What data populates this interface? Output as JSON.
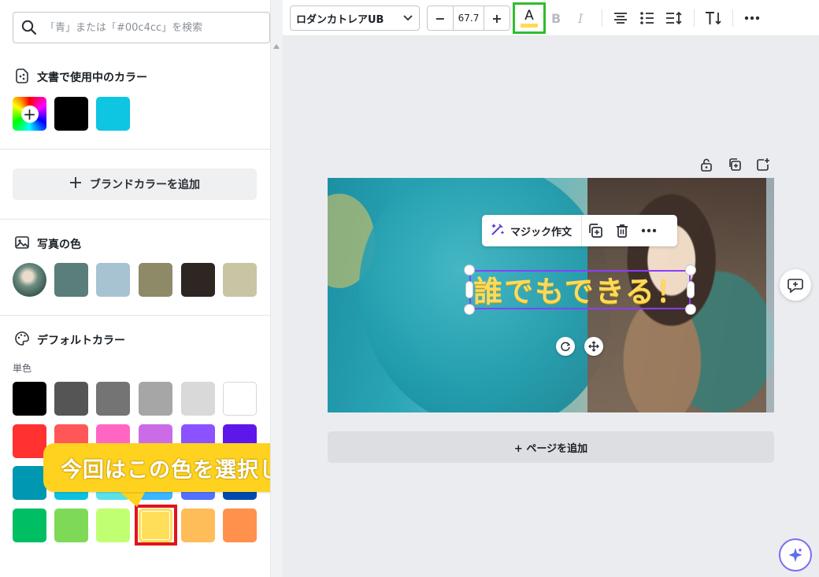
{
  "search": {
    "placeholder": "「青」または「#00c4cc」を検索"
  },
  "sections": {
    "document_colors": "文書で使用中のカラー",
    "brand_button": "ブランドカラーを追加",
    "photo_colors": "写真の色",
    "default_colors": "デフォルトカラー",
    "solid_label": "単色"
  },
  "colors": {
    "document": [
      "#000000",
      "#0ec5e2"
    ],
    "photo": [
      "#5a7e79",
      "#a7c3d2",
      "#8e8a67",
      "#2d2623",
      "#c7c5a4"
    ],
    "default_rows": [
      [
        "#000000",
        "#555555",
        "#747474",
        "#a6a6a6",
        "#d9d9d9",
        "#ffffff"
      ],
      [
        "#ff3131",
        "#ff5757",
        "#ff66c4",
        "#cb6ce6",
        "#8c52ff",
        "#5e17eb"
      ],
      [
        "#0097b2",
        "#0cc0df",
        "#5ce1e6",
        "#38b6ff",
        "#5271ff",
        "#004aad"
      ],
      [
        "#00bf63",
        "#7ed957",
        "#c1ff72",
        "#ffde59",
        "#ffbd59",
        "#ff914d"
      ]
    ],
    "accent_green": "#2fbd2f",
    "highlight_red": "#e0141e",
    "callout_yellow": "#ffd21f",
    "selection_purple": "#8b3dff"
  },
  "callout": {
    "text": "今回はこの色を選択します"
  },
  "toolbar": {
    "font": "ロダンカトレアUB",
    "size": "67.7",
    "minus": "−",
    "plus": "+",
    "text_color_letter": "A"
  },
  "canvas": {
    "magic_write": "マジック作文",
    "text": "誰でもできる！",
    "add_page": "+ ページを追加"
  }
}
